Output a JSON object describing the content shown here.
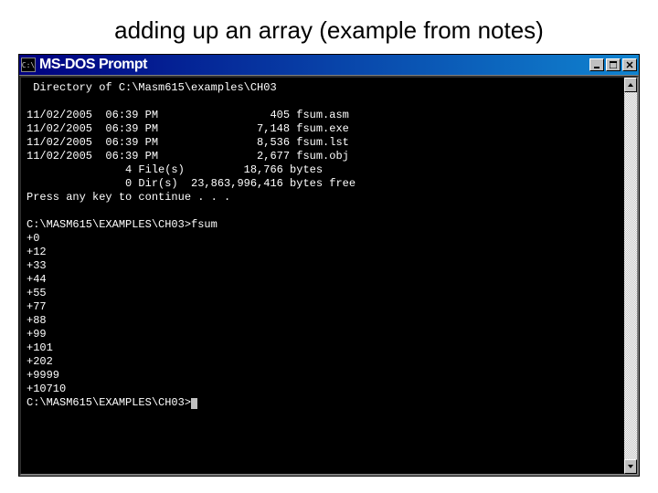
{
  "slide": {
    "title": "adding up an array (example from notes)"
  },
  "window": {
    "icon_label": "C:\\",
    "title": "MS-DOS Prompt"
  },
  "terminal": {
    "header": " Directory of C:\\Masm615\\examples\\CH03",
    "files": [
      {
        "date": "11/02/2005",
        "time": "06:39 PM",
        "size": "405",
        "name": "fsum.asm"
      },
      {
        "date": "11/02/2005",
        "time": "06:39 PM",
        "size": "7,148",
        "name": "fsum.exe"
      },
      {
        "date": "11/02/2005",
        "time": "06:39 PM",
        "size": "8,536",
        "name": "fsum.lst"
      },
      {
        "date": "11/02/2005",
        "time": "06:39 PM",
        "size": "2,677",
        "name": "fsum.obj"
      }
    ],
    "summary": {
      "file_count": "4",
      "file_bytes": "18,766",
      "dir_count": "0",
      "free_bytes": "23,863,996,416"
    },
    "press_any_key": "Press any key to continue . . .",
    "prompt1": "C:\\MASM615\\EXAMPLES\\CH03>fsum",
    "outputs": [
      "+0",
      "+12",
      "+33",
      "+44",
      "+55",
      "+77",
      "+88",
      "+99",
      "+101",
      "+202",
      "+9999",
      "+10710"
    ],
    "prompt2": "C:\\MASM615\\EXAMPLES\\CH03>"
  }
}
